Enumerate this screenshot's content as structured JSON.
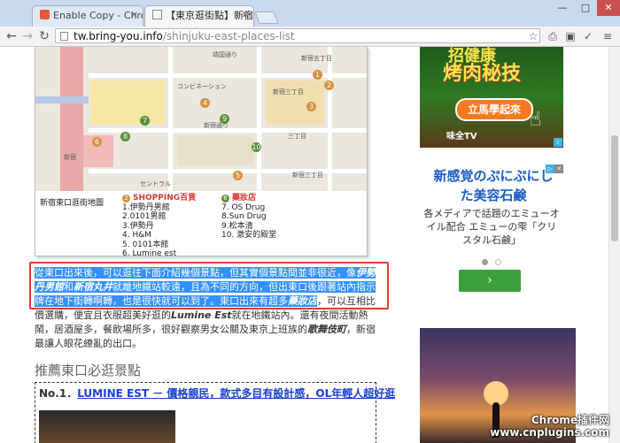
{
  "browser": {
    "tabs": [
      {
        "title": "Enable Copy - Chrome 扩",
        "active": false
      },
      {
        "title": "【東京逛街點】新宿東口",
        "active": true
      }
    ],
    "url_host": "tw.bring-you.info",
    "url_path": "/shinjuku-east-places-list",
    "window_controls": {
      "minimize": "—",
      "maximize": "□",
      "close": "✕"
    }
  },
  "map": {
    "caption": "新宿東口逛街地圖",
    "shopping_header": "SHOPPING百貨",
    "shopping_items": [
      "1.伊勢丹男館",
      "2.0101男館",
      "3.伊勢丹",
      "4. H&M",
      "5. 0101本館",
      "6. Lumine est"
    ],
    "drug_header": "藥妝店",
    "drug_items": [
      "7. OS Drug",
      "8.Sun Drug",
      "9.松本清",
      "10. 激安的殿堂"
    ],
    "pin_numbers": [
      "1",
      "2",
      "3",
      "4",
      "5",
      "6",
      "7",
      "8",
      "9",
      "10"
    ],
    "labels": [
      "新宿三丁目",
      "三丁目",
      "新宿",
      "コンビネーション",
      "新宿通り",
      "靖国通り",
      "セントラル",
      "新宿五丁目",
      "新宿三丁目"
    ]
  },
  "article": {
    "highlighted": {
      "s1": "從東口出來後，可以逛往下面介紹幾個景點，但其實個景點間並非很近，像",
      "b1": "伊勢丹男館",
      "s2": "和",
      "b2": "新宿丸井",
      "s3": "就離地鐵站較遠，且為不同的方向，但出東口後跟著站內指示牌在地下街轉啊轉，也是很快就可以到了。東口出來有超多",
      "b3": "藥妝店"
    },
    "after_highlight": "，可以互相比價選購，便宜且衣服超美好逛的",
    "b4": "Lumine Est",
    "s5": "就在地鐵站內。還有夜間活動熱鬧，居酒屋多，餐飲場所多，很好觀察男女公關及東京上班族的",
    "b5": "歌舞伎町",
    "s6": "，新宿最讓人眼花繚亂的出口。",
    "section_title": "推薦東口必逛景點",
    "item_prefix": "No.1．",
    "item_link": "LUMINE EST － 價格親民，款式多目有設計感，OL年輕人超好逛"
  },
  "ads": {
    "ad1_line1": "招健康",
    "ad1_line2": "烤肉秘技",
    "ad1_button": "立馬學起來",
    "ad1_brand": "味全TV",
    "ad2_headline": "新感覚のぷにぷにした美容石鹸",
    "ad2_body": "各メディアで話題のエミューオイル配合 エミューの雫「クリスタル石鹸」",
    "ad2_button": "›",
    "carousel_active": "#999999",
    "carousel_inactive": "#dddddd"
  },
  "watermark": {
    "line1": "Chrome插件网",
    "line2": "www.cnplugins.com"
  },
  "colors": {
    "highlight": "#3390ff",
    "redbox": "#e53935",
    "link": "#1a3fd6",
    "green_button": "#3b9f3c"
  }
}
